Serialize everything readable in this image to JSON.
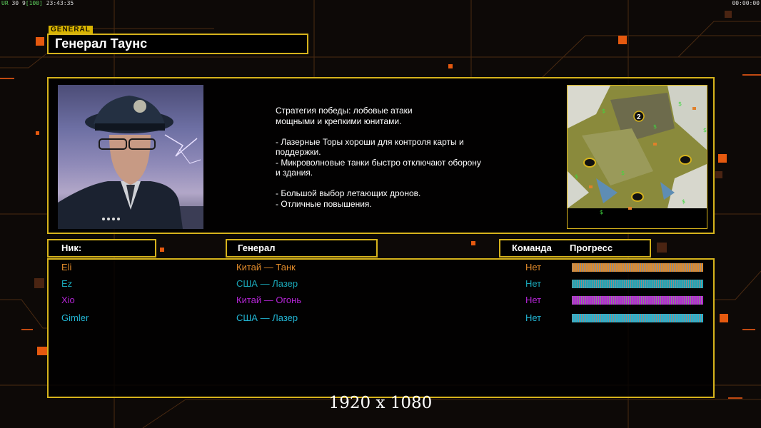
{
  "hud": {
    "left_prefix": "UR",
    "left_fps": "30",
    "left_mid": "9",
    "left_bracket": "[100]",
    "left_time": "23:43:35",
    "right_time": "00:00:00"
  },
  "general": {
    "tag": "GENERAL",
    "name": "Генерал Таунс",
    "description": "Стратегия победы: лобовые атаки\nмощными и крепкими юнитами.\n\n- Лазерные Торы хороши для контроля карты и\n поддержки.\n- Микроволновые танки быстро отключают оборону\n и здания.\n\n- Большой выбор летающих дронов.\n- Отличные повышения."
  },
  "minimap": {
    "label": "2"
  },
  "columns": {
    "nick": "Ник:",
    "general": "Генерал",
    "team": "Команда",
    "progress": "Прогресс"
  },
  "players": [
    {
      "nick": "Eli",
      "general": "Китай — Танк",
      "team": "Нет",
      "color": "#e08a2a",
      "progress": 1.0
    },
    {
      "nick": "Ez",
      "general": "США — Лазер",
      "team": "Нет",
      "color": "#1aa6b7",
      "progress": 1.0
    },
    {
      "nick": "Xio",
      "general": "Китай — Огонь",
      "team": "Нет",
      "color": "#b526d6",
      "progress": 1.0
    },
    {
      "nick": "Gimler",
      "general": "США — Лазер",
      "team": "Нет",
      "color": "#22b4d2",
      "progress": 1.0
    }
  ],
  "resolution_label": "1920 x 1080",
  "colors": {
    "accent": "#d6b31c",
    "background": "#0d0907",
    "line": "#4a2a10"
  }
}
